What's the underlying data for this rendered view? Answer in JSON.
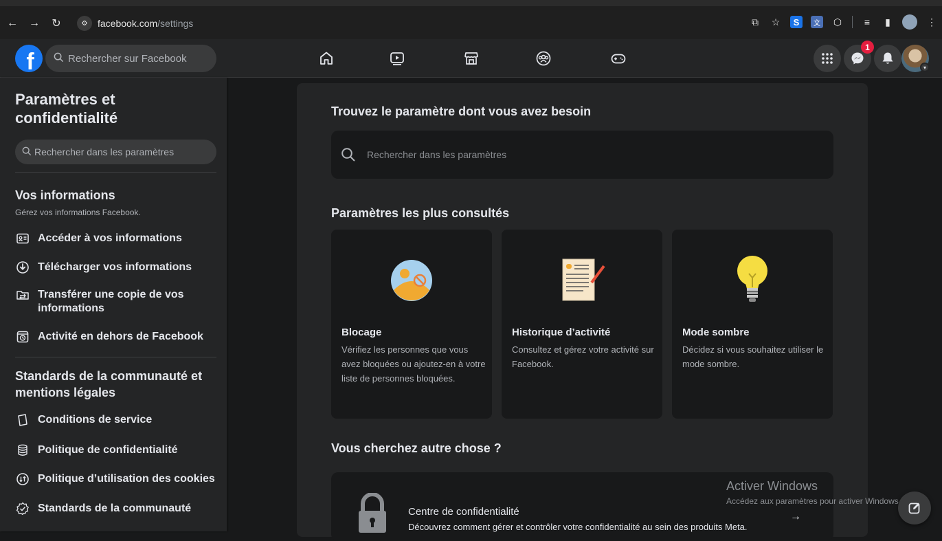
{
  "browser": {
    "url_host": "facebook.com",
    "url_path": "/settings",
    "nav_icons": [
      "back-arrow-icon",
      "forward-arrow-icon",
      "reload-icon"
    ],
    "extensions": [
      "cast-icon",
      "bookmark-star-icon",
      "s-extension-icon",
      "translate-extension-icon",
      "extensions-puzzle-icon",
      "reading-list-icon",
      "side-panel-icon",
      "profile-icon",
      "more-menu-icon"
    ]
  },
  "header": {
    "logo_letter": "f",
    "search_placeholder": "Rechercher sur Facebook",
    "nav": [
      "home-icon",
      "video-icon",
      "marketplace-icon",
      "groups-icon",
      "gaming-icon"
    ],
    "messenger_badge": "1",
    "right_icons": [
      "menu-grid-icon",
      "messenger-icon",
      "notifications-bell-icon",
      "account-avatar"
    ]
  },
  "sidebar": {
    "title": "Paramètres et confidentialité",
    "search_placeholder": "Rechercher dans les paramètres",
    "section1": {
      "title": "Vos informations",
      "subtitle": "Gérez vos informations Facebook.",
      "items": [
        {
          "label": "Accéder à vos informations",
          "icon": "id-card-icon"
        },
        {
          "label": "Télécharger vos informations",
          "icon": "download-icon"
        },
        {
          "label": "Transférer une copie de vos informations",
          "icon": "folder-transfer-icon"
        },
        {
          "label": "Activité en dehors de Facebook",
          "icon": "off-facebook-activity-icon"
        }
      ]
    },
    "section2": {
      "title": "Standards de la communauté et mentions légales",
      "items": [
        {
          "label": "Conditions de service",
          "icon": "book-icon"
        },
        {
          "label": "Politique de confidentialité",
          "icon": "database-icon"
        },
        {
          "label": "Politique d’utilisation des cookies",
          "icon": "cookie-icon"
        },
        {
          "label": "Standards de la communauté",
          "icon": "badge-check-icon"
        }
      ]
    }
  },
  "main": {
    "find_heading": "Trouvez le paramètre dont vous avez besoin",
    "search_placeholder": "Rechercher dans les paramètres",
    "most_heading": "Paramètres les plus consultés",
    "tiles": [
      {
        "title": "Blocage",
        "desc": "Vérifiez les personnes que vous avez bloquées ou ajoutez-en à votre liste de personnes bloquées."
      },
      {
        "title": "Historique d’activité",
        "desc": "Consultez et gérez votre activité sur Facebook."
      },
      {
        "title": "Mode sombre",
        "desc": "Décidez si vous souhaitez utiliser le mode sombre."
      }
    ],
    "else_heading": "Vous cherchez autre chose ?",
    "privacy_card": {
      "title": "Centre de confidentialité",
      "desc": "Découvrez comment gérer et contrôler votre confidentialité au sein des produits Meta.",
      "arrow": "→"
    }
  },
  "watermark": {
    "title": "Activer Windows",
    "subtitle": "Accédez aux paramètres pour activer Windows."
  },
  "colors": {
    "accent": "#1877f2",
    "badge": "#e41e3f",
    "background": "#18191a",
    "surface": "#242526"
  }
}
